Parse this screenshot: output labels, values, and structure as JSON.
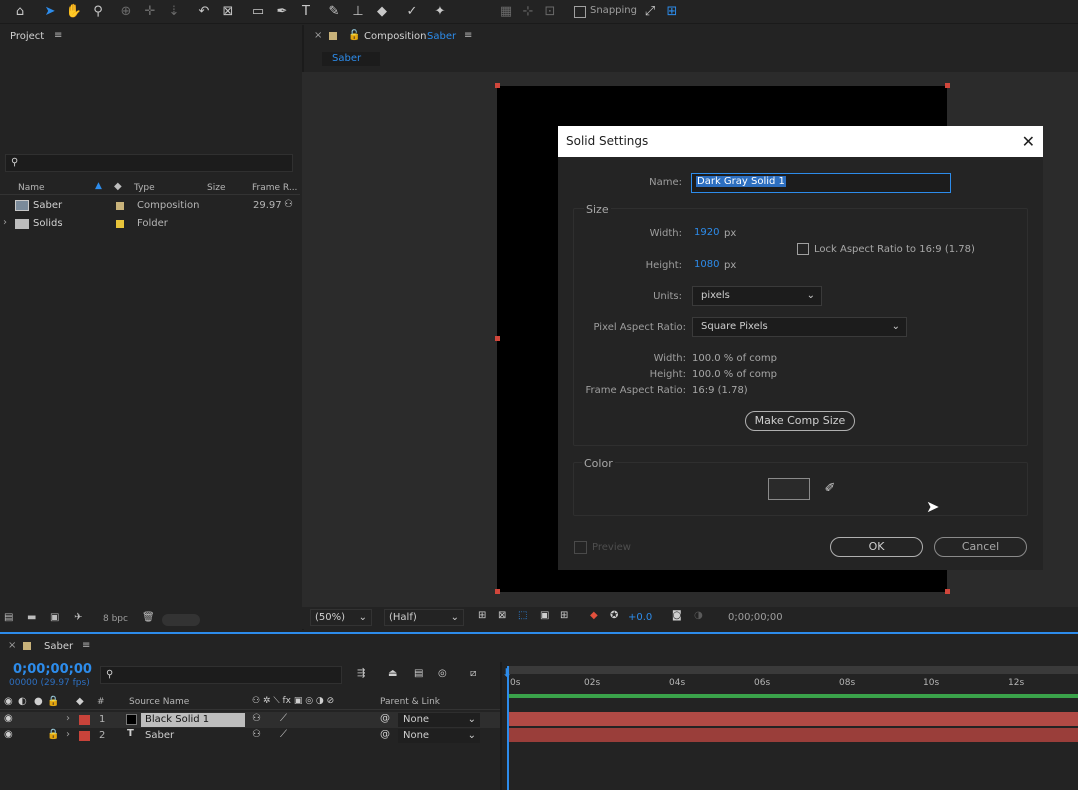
{
  "toolbar": {
    "snapping_label": "Snapping",
    "icons": [
      "home-icon",
      "selection-arrow-icon",
      "hand-icon",
      "zoom-icon",
      "orbit-icon",
      "pan-icon",
      "dolly-icon",
      "rotate-icon",
      "camera-track-icon",
      "rectangle-icon",
      "pen-icon",
      "type-icon",
      "brush-icon",
      "clone-stamp-icon",
      "eraser-icon",
      "roto-brush-icon",
      "puppet-pin-icon"
    ]
  },
  "project_panel": {
    "title": "Project",
    "search_placeholder": "",
    "columns": {
      "name": "Name",
      "type": "Type",
      "size": "Size",
      "frame_rate": "Frame R..."
    },
    "items": [
      {
        "name": "Saber",
        "type": "Composition",
        "frame_rate": "29.97",
        "label_color": "#c8b27a"
      },
      {
        "name": "Solids",
        "type": "Folder",
        "frame_rate": "",
        "label_color": "#e8c43a"
      }
    ],
    "bpc": "8 bpc"
  },
  "comp_panel": {
    "title_prefix": "Composition",
    "title_comp": "Saber",
    "tab": "Saber",
    "zoom": "(50%)",
    "resolution": "(Half)",
    "exposure": "+0.0",
    "timecode": "0;00;00;00"
  },
  "dialog": {
    "title": "Solid Settings",
    "name_label": "Name:",
    "name_value": "Dark Gray Solid 1",
    "size_group": "Size",
    "width_label": "Width:",
    "width_value": "1920",
    "height_label": "Height:",
    "height_value": "1080",
    "unit_px": "px",
    "lock_label": "Lock Aspect Ratio to 16:9 (1.78)",
    "units_label": "Units:",
    "units_value": "pixels",
    "par_label": "Pixel Aspect Ratio:",
    "par_value": "Square Pixels",
    "info_width_label": "Width:",
    "info_width_value": "100.0 % of comp",
    "info_height_label": "Height:",
    "info_height_value": "100.0 % of comp",
    "far_label": "Frame Aspect Ratio:",
    "far_value": "16:9 (1.78)",
    "make_comp_size": "Make Comp Size",
    "color_group": "Color",
    "swatch_color": "#2a2a2a",
    "preview_label": "Preview",
    "ok_label": "OK",
    "cancel_label": "Cancel"
  },
  "timeline": {
    "comp_tab": "Saber",
    "timecode": "0;00;00;00",
    "fps_info": "00000 (29.97 fps)",
    "columns": {
      "num": "#",
      "source": "Source Name",
      "parent": "Parent & Link"
    },
    "ruler": [
      "0s",
      "02s",
      "04s",
      "06s",
      "08s",
      "10s",
      "12s"
    ],
    "layers": [
      {
        "num": "1",
        "name": "Black Solid 1",
        "parent": "None",
        "color": "#c8433a"
      },
      {
        "num": "2",
        "name": "Saber",
        "parent": "None",
        "color": "#c8433a"
      }
    ]
  }
}
